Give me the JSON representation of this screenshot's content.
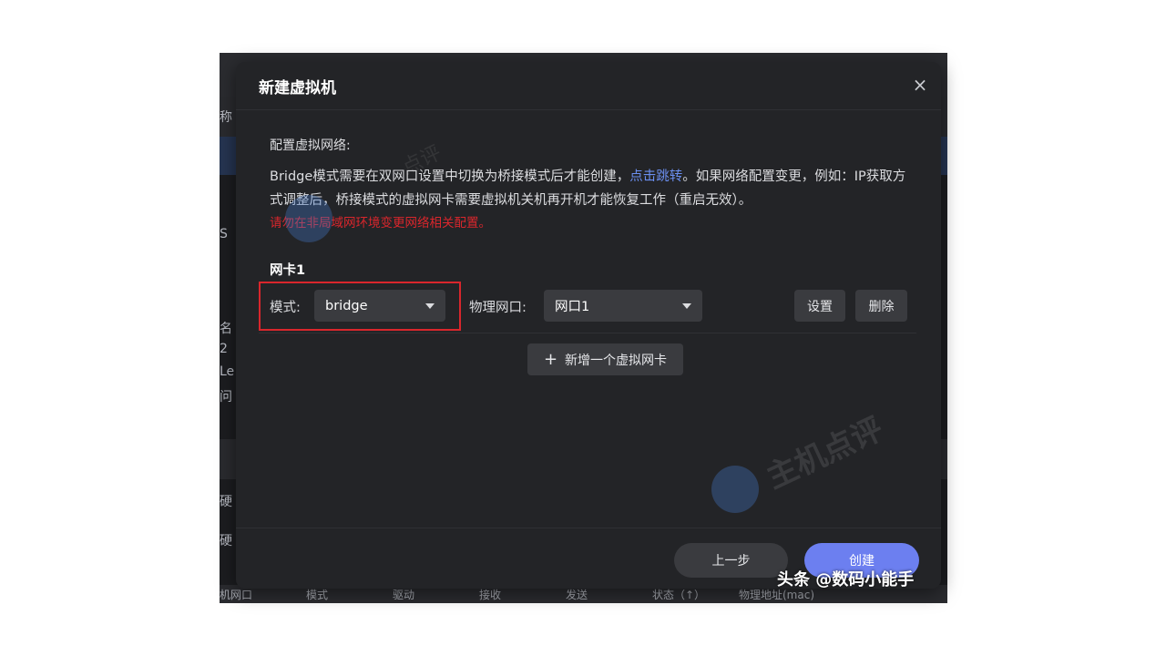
{
  "background_fragments": {
    "name_col": "称",
    "s_char": "S",
    "name2": "名",
    "num": "2",
    "le": "Le",
    "ask": "问",
    "disk1": "硬",
    "disk2": "硬",
    "footer_headers": [
      "机网口",
      "模式",
      "驱动",
      "接收",
      "发送",
      "状态（↑）",
      "物理地址(mac)"
    ]
  },
  "dialog": {
    "title": "新建虚拟机",
    "close_glyph": "×",
    "section_label": "配置虚拟网络:",
    "desc_part1": "Bridge模式需要在双网口设置中切换为桥接模式后才能创建，",
    "desc_link": "点击跳转",
    "desc_part2": "。如果网络配置变更，例如：IP获取方式调整后，桥接模式的虚拟网卡需要虚拟机关机再开机才能恢复工作（重启无效）。",
    "warning": "请勿在非局域网环境变更网络相关配置。",
    "nic": {
      "title": "网卡1",
      "mode_label": "模式:",
      "mode_value": "bridge",
      "port_label": "物理网口:",
      "port_value": "网口1",
      "settings_label": "设置",
      "delete_label": "删除"
    },
    "add_nic_label": "新增一个虚拟网卡",
    "prev_label": "上一步",
    "create_label": "创建"
  },
  "watermarks": {
    "main": "主机点评",
    "small": "点评"
  },
  "credit": "头条 @数码小能手",
  "colors": {
    "accent": "#6c7ff0",
    "link": "#6b8ff0",
    "warning": "#d9262c",
    "dialog_bg": "#232427"
  }
}
